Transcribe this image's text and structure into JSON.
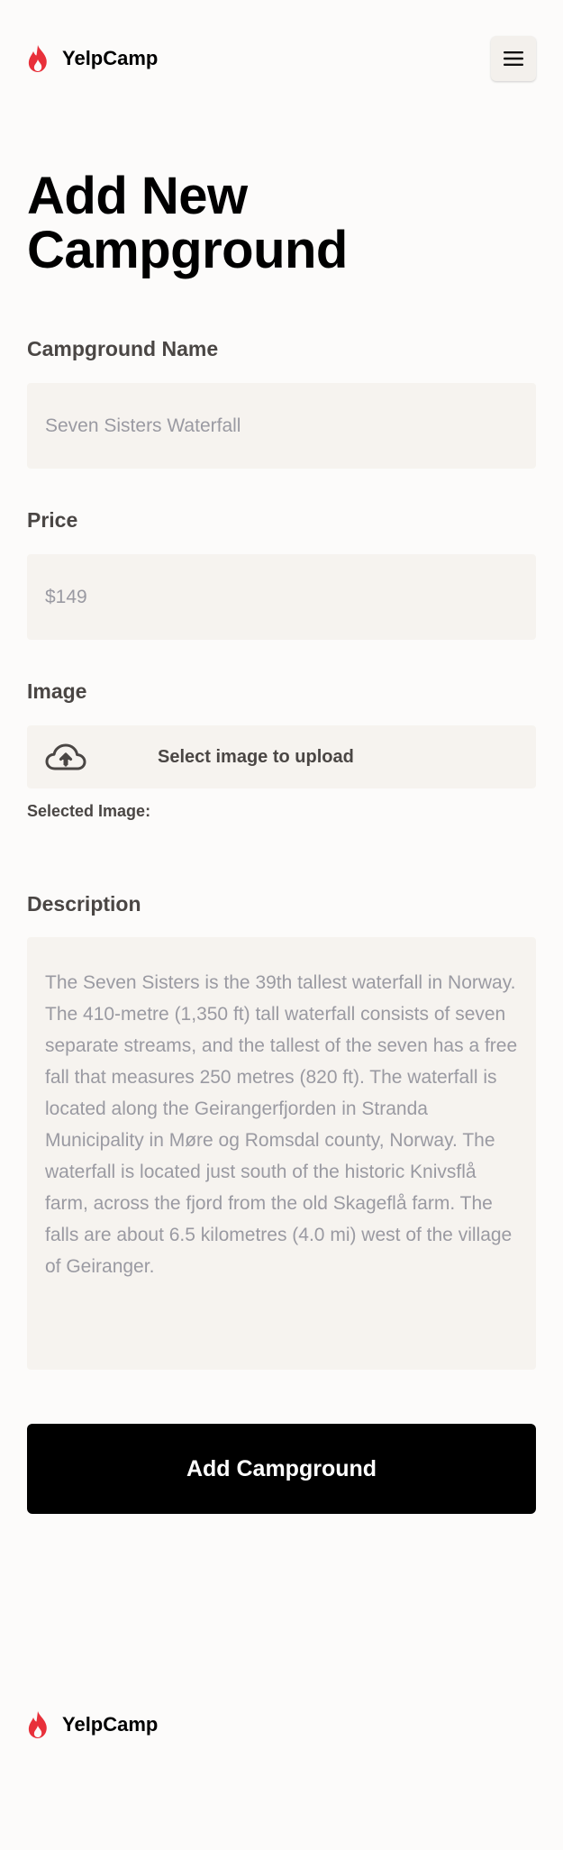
{
  "brand": {
    "name": "YelpCamp",
    "logo_icon": "flame-icon",
    "logo_color": "#e8303a"
  },
  "header": {
    "menu_icon": "hamburger-menu-icon"
  },
  "page": {
    "title": "Add New Campground"
  },
  "form": {
    "name_label": "Campground Name",
    "name_placeholder": "Seven Sisters Waterfall",
    "price_label": "Price",
    "price_placeholder": "$149",
    "image_label": "Image",
    "upload_icon": "cloud-upload-icon",
    "upload_text": "Select image to upload",
    "selected_image_label": "Selected Image:",
    "description_label": "Description",
    "description_placeholder": "The Seven Sisters is the 39th tallest waterfall in Norway. The 410-metre (1,350 ft) tall waterfall consists of seven separate streams, and the tallest of the seven has a free fall that measures 250 metres (820 ft). The waterfall is located along the Geirangerfjorden in Stranda Municipality in Møre og Romsdal county, Norway. The waterfall is located just south of the historic Knivsflå farm, across the fjord from the old Skageflå farm. The falls are about 6.5 kilometres (4.0 mi) west of the village of Geiranger.",
    "submit_label": "Add Campground"
  },
  "footer": {
    "brand_name": "YelpCamp"
  },
  "colors": {
    "background": "#fcfbfa",
    "field_background": "#f6f3ef",
    "label_text": "#4a4644",
    "placeholder_text": "#9a9aa2",
    "button_background": "#000000",
    "button_text": "#ffffff"
  }
}
